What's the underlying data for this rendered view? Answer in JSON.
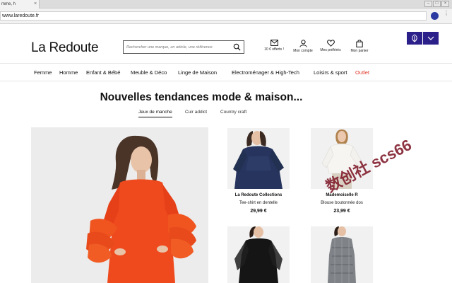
{
  "browser": {
    "tab_title": "mme, h",
    "tab_close": "×",
    "url": "www.laredoute.fr"
  },
  "site": {
    "logo": "La Redoute",
    "search_placeholder": "Rechercher une marque, un article, une référence",
    "header_items": [
      {
        "label": "10 € offerts !",
        "icon": "mail-icon"
      },
      {
        "label": "Mon compte",
        "icon": "user-icon"
      },
      {
        "label": "Mes préférés",
        "icon": "heart-icon"
      },
      {
        "label": "Mon panier",
        "icon": "bag-icon"
      }
    ],
    "accent_color": "#2b1f8a"
  },
  "nav": {
    "items": [
      "Femme",
      "Homme",
      "Enfant & Bébé",
      "Meuble & Déco",
      "Linge de Maison",
      "Electroménager & High-Tech",
      "Loisirs & sport",
      "Outlet"
    ],
    "outlet_color": "#e03a2b"
  },
  "main": {
    "heading": "Nouvelles tendances mode & maison...",
    "tabs": [
      {
        "label": "Jeux de manche",
        "active": true
      },
      {
        "label": "Cuir addict",
        "active": false
      },
      {
        "label": "Country craft",
        "active": false
      }
    ],
    "products": [
      {
        "brand": "La Redoute Collections",
        "desc": "Tee-shirt en dentelle",
        "price": "29,99 €"
      },
      {
        "brand": "Mademoiselle R",
        "desc": "Blouse boutonnée dos",
        "price": "23,99 €"
      }
    ]
  },
  "watermark": "数创社 scs66"
}
